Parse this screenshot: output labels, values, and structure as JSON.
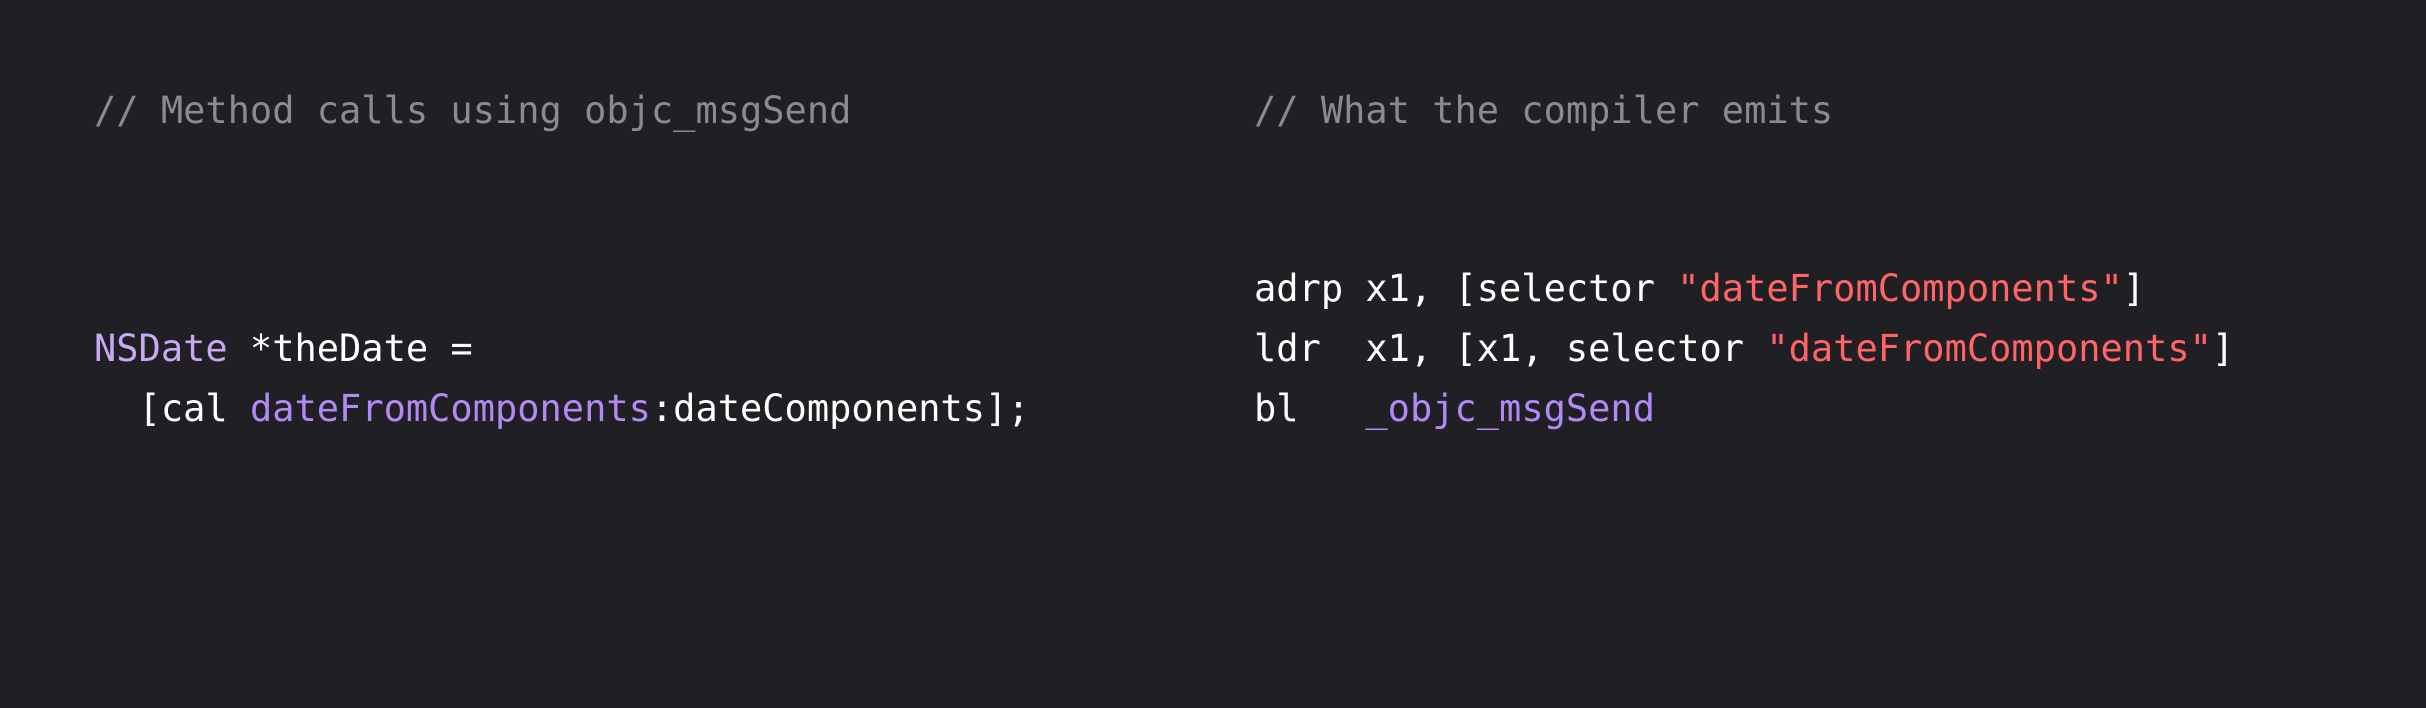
{
  "left_panel": {
    "comment": "// Method calls using objc_msgSend",
    "line1": {
      "type": "NSDate",
      "rest": " *theDate ="
    },
    "line2": {
      "prefix": "  [cal ",
      "method": "dateFromComponents",
      "suffix": ":dateComponents];"
    }
  },
  "right_panel": {
    "comment": "// What the compiler emits",
    "lines": [
      {
        "prefix": "adrp x1, [selector ",
        "string": "\"dateFromComponents\"",
        "suffix": "]"
      },
      {
        "prefix": "ldr  x1, [x1, selector ",
        "string": "\"dateFromComponents\"",
        "suffix": "]"
      },
      {
        "prefix": "bl   ",
        "func": "_objc_msgSend"
      }
    ]
  },
  "colors": {
    "background": "#1f1f24",
    "comment": "#8a8a92",
    "plain": "#ffffff",
    "type": "#c8a8f0",
    "method": "#b389f5",
    "string": "#ff6467"
  }
}
